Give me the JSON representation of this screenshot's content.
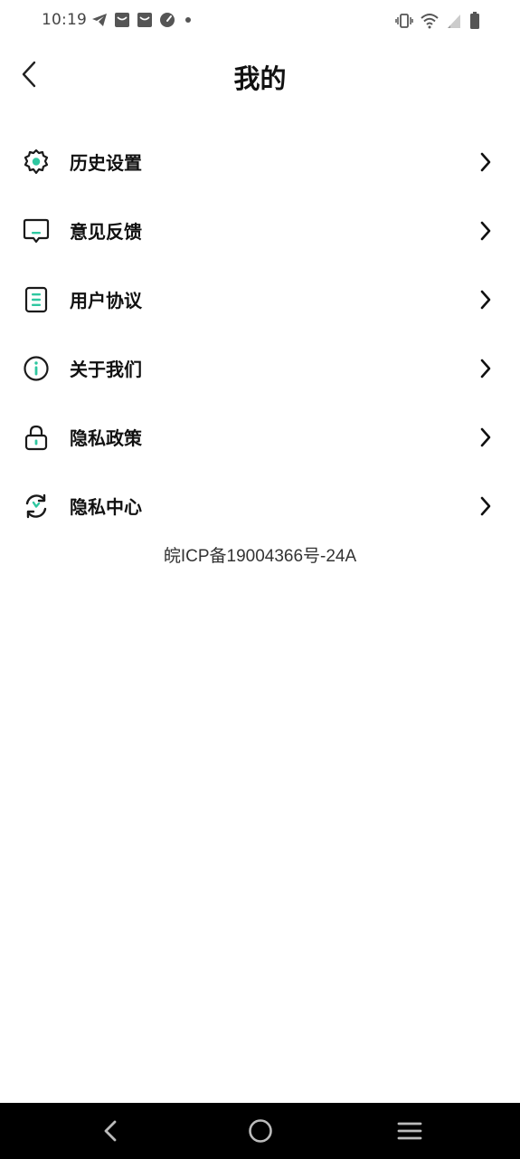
{
  "status_bar": {
    "time": "10:19",
    "left_icons": [
      "telegram-icon",
      "mail-icon",
      "mail-icon",
      "speedometer-icon",
      "dot-icon"
    ],
    "right_icons": [
      "vibrate-icon",
      "wifi-icon",
      "signal-icon",
      "battery-icon"
    ]
  },
  "header": {
    "title": "我的"
  },
  "menu": {
    "items": [
      {
        "label": "历史设置",
        "icon": "gear-icon"
      },
      {
        "label": "意见反馈",
        "icon": "feedback-icon"
      },
      {
        "label": "用户协议",
        "icon": "document-icon"
      },
      {
        "label": "关于我们",
        "icon": "info-icon"
      },
      {
        "label": "隐私政策",
        "icon": "lock-icon"
      },
      {
        "label": "隐私中心",
        "icon": "sync-icon"
      }
    ]
  },
  "footer": {
    "icp": "皖ICP备19004366号-24A"
  },
  "colors": {
    "accent": "#2ec7a0",
    "text": "#111111",
    "nav_bar": "#000000"
  }
}
